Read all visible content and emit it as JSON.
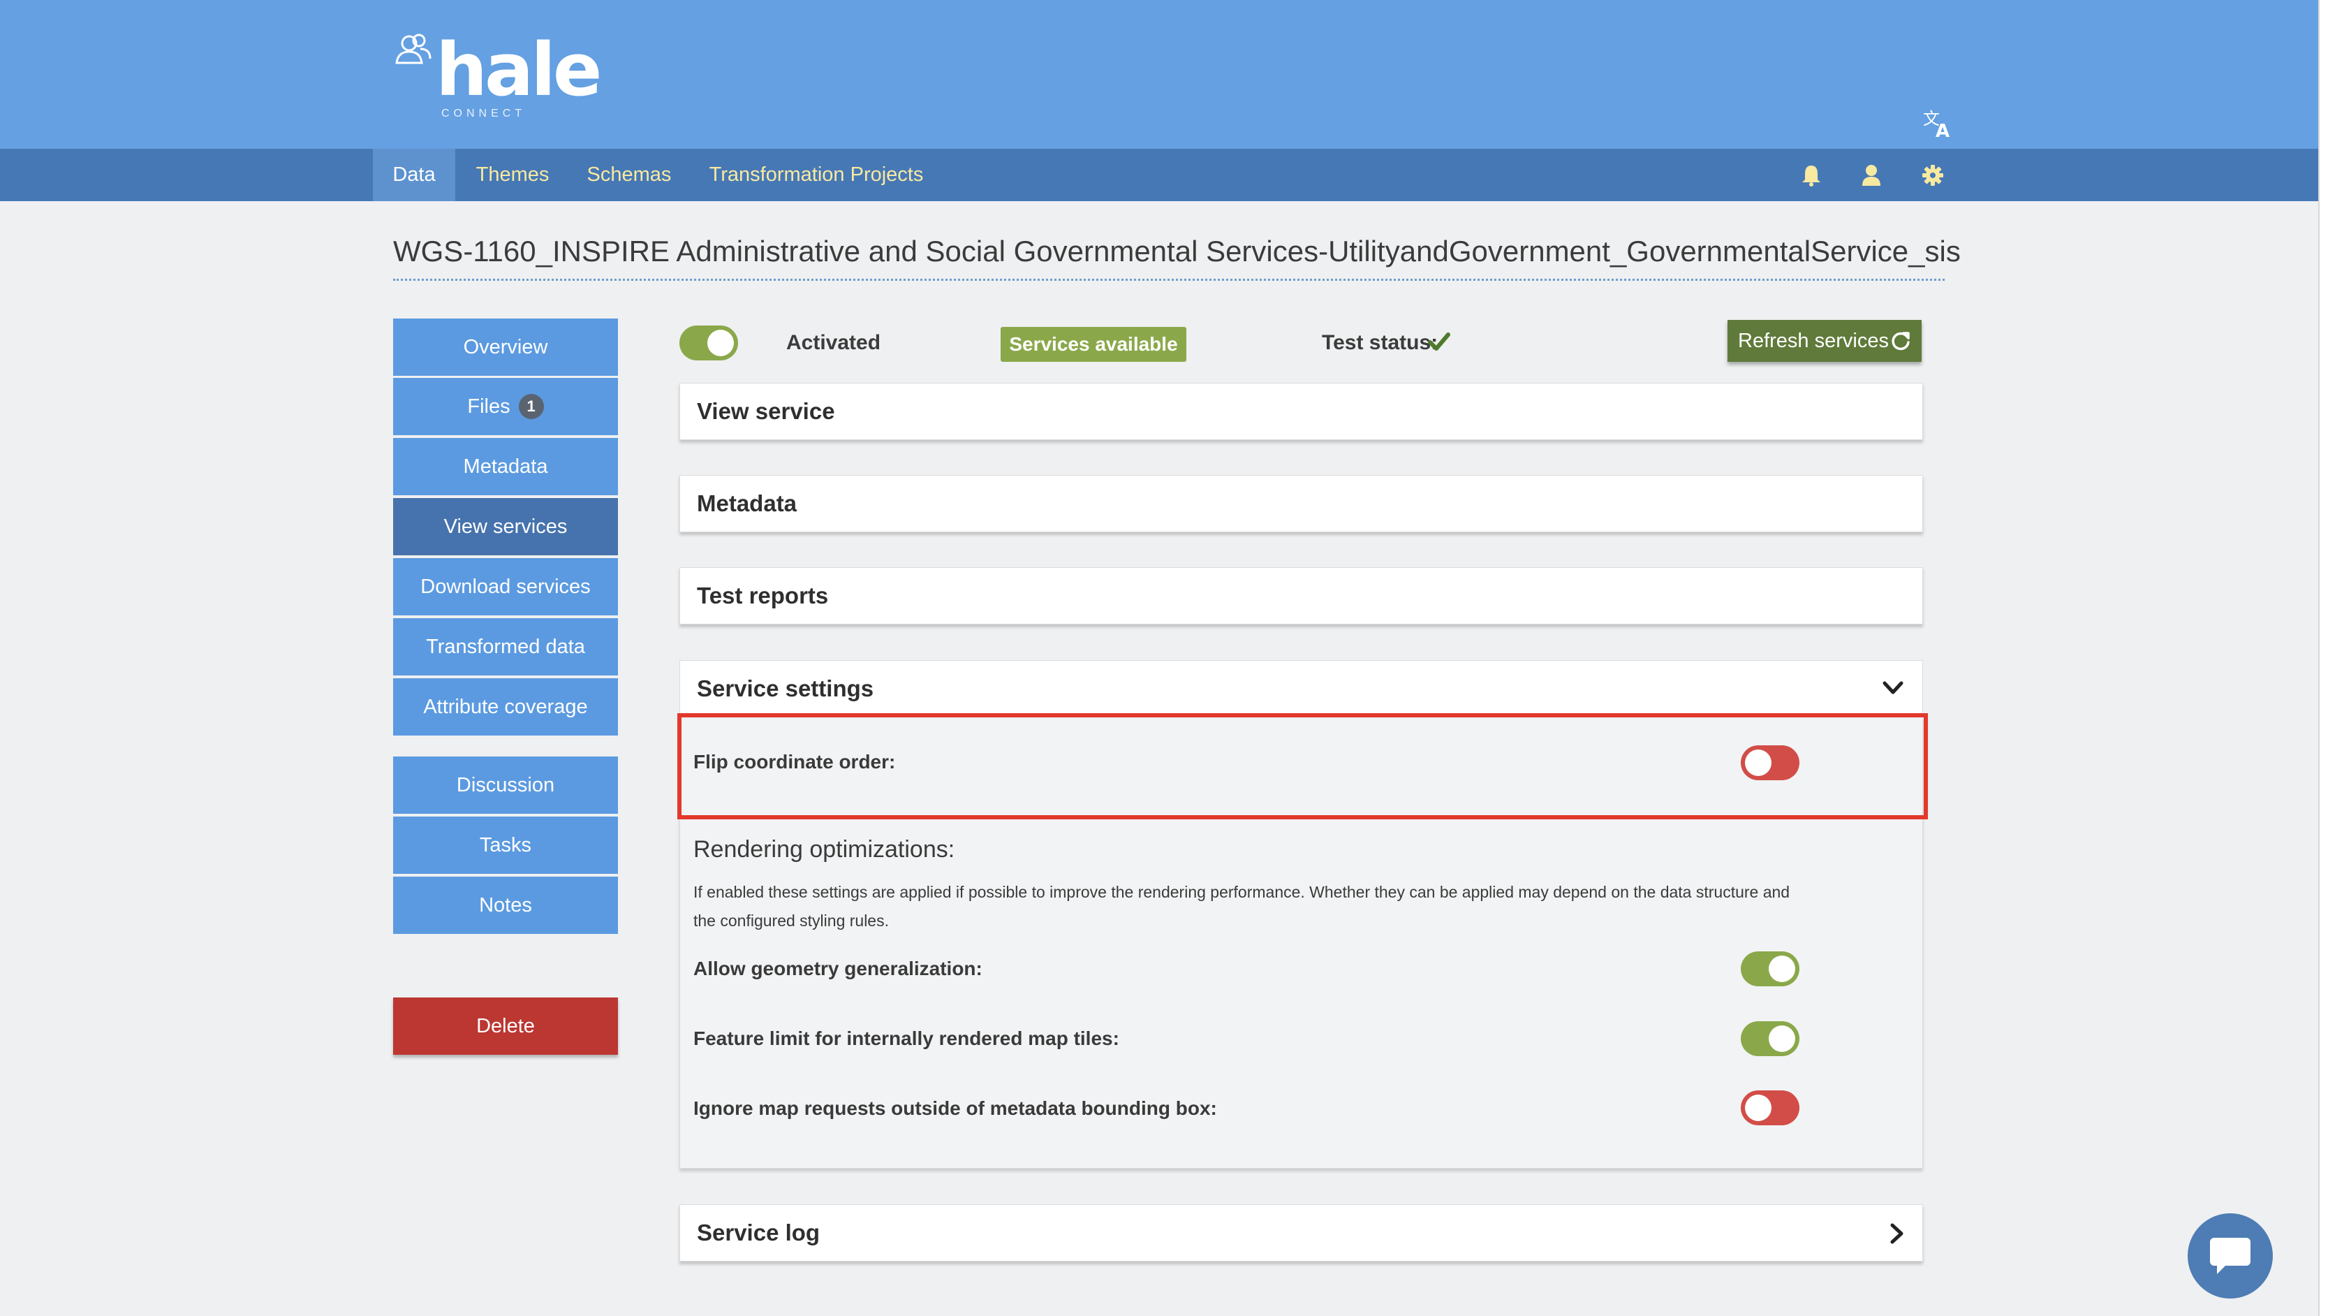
{
  "brand": {
    "logo_word": "hale",
    "logo_sub": "CONNECT"
  },
  "top_nav": {
    "items": [
      {
        "label": "Data",
        "active": true
      },
      {
        "label": "Themes"
      },
      {
        "label": "Schemas"
      },
      {
        "label": "Transformation Projects"
      }
    ],
    "icons": [
      "translate-icon",
      "bell-icon",
      "user-icon",
      "gear-icon"
    ]
  },
  "page_title": "WGS-1160_INSPIRE Administrative and Social Governmental Services-UtilityandGovernment_GovernmentalService_sis",
  "sidebar": {
    "items": [
      {
        "label": "Overview"
      },
      {
        "label": "Files",
        "badge": "1"
      },
      {
        "label": "Metadata"
      },
      {
        "label": "View services",
        "active": true
      },
      {
        "label": "Download services"
      },
      {
        "label": "Transformed data"
      },
      {
        "label": "Attribute coverage"
      },
      {
        "label": "Discussion"
      },
      {
        "label": "Tasks"
      },
      {
        "label": "Notes"
      }
    ],
    "delete_label": "Delete"
  },
  "status_row": {
    "activated_label": "Activated",
    "activated": true,
    "services_badge": "Services available",
    "test_status_label": "Test status:",
    "test_status_icon": "check-icon",
    "refresh_label": "Refresh services"
  },
  "panels": {
    "view_service": "View service",
    "metadata": "Metadata",
    "test_reports": "Test reports",
    "service_settings": "Service settings",
    "service_log": "Service log"
  },
  "service_settings": {
    "flip_label": "Flip coordinate order:",
    "flip_on": false,
    "rendering_heading": "Rendering optimizations:",
    "rendering_desc_line1": "If enabled these settings are applied if possible to improve the rendering performance. Whether they can be applied may depend on the data structure and",
    "rendering_desc_line2": "the configured styling rules.",
    "options": [
      {
        "label": "Allow geometry generalization:",
        "on": true
      },
      {
        "label": "Feature limit for internally rendered map tiles:",
        "on": true
      },
      {
        "label": "Ignore map requests outside of metadata bounding box:",
        "on": false
      }
    ]
  },
  "colors": {
    "header": "#64a0e2",
    "navbar": "#4678b6",
    "sidebar": "#5b9ae0",
    "sidebar_active": "#4673ad",
    "toggle_on": "#8aa84a",
    "toggle_off": "#d24d48",
    "delete": "#bc3732",
    "highlight": "#e2392c"
  }
}
